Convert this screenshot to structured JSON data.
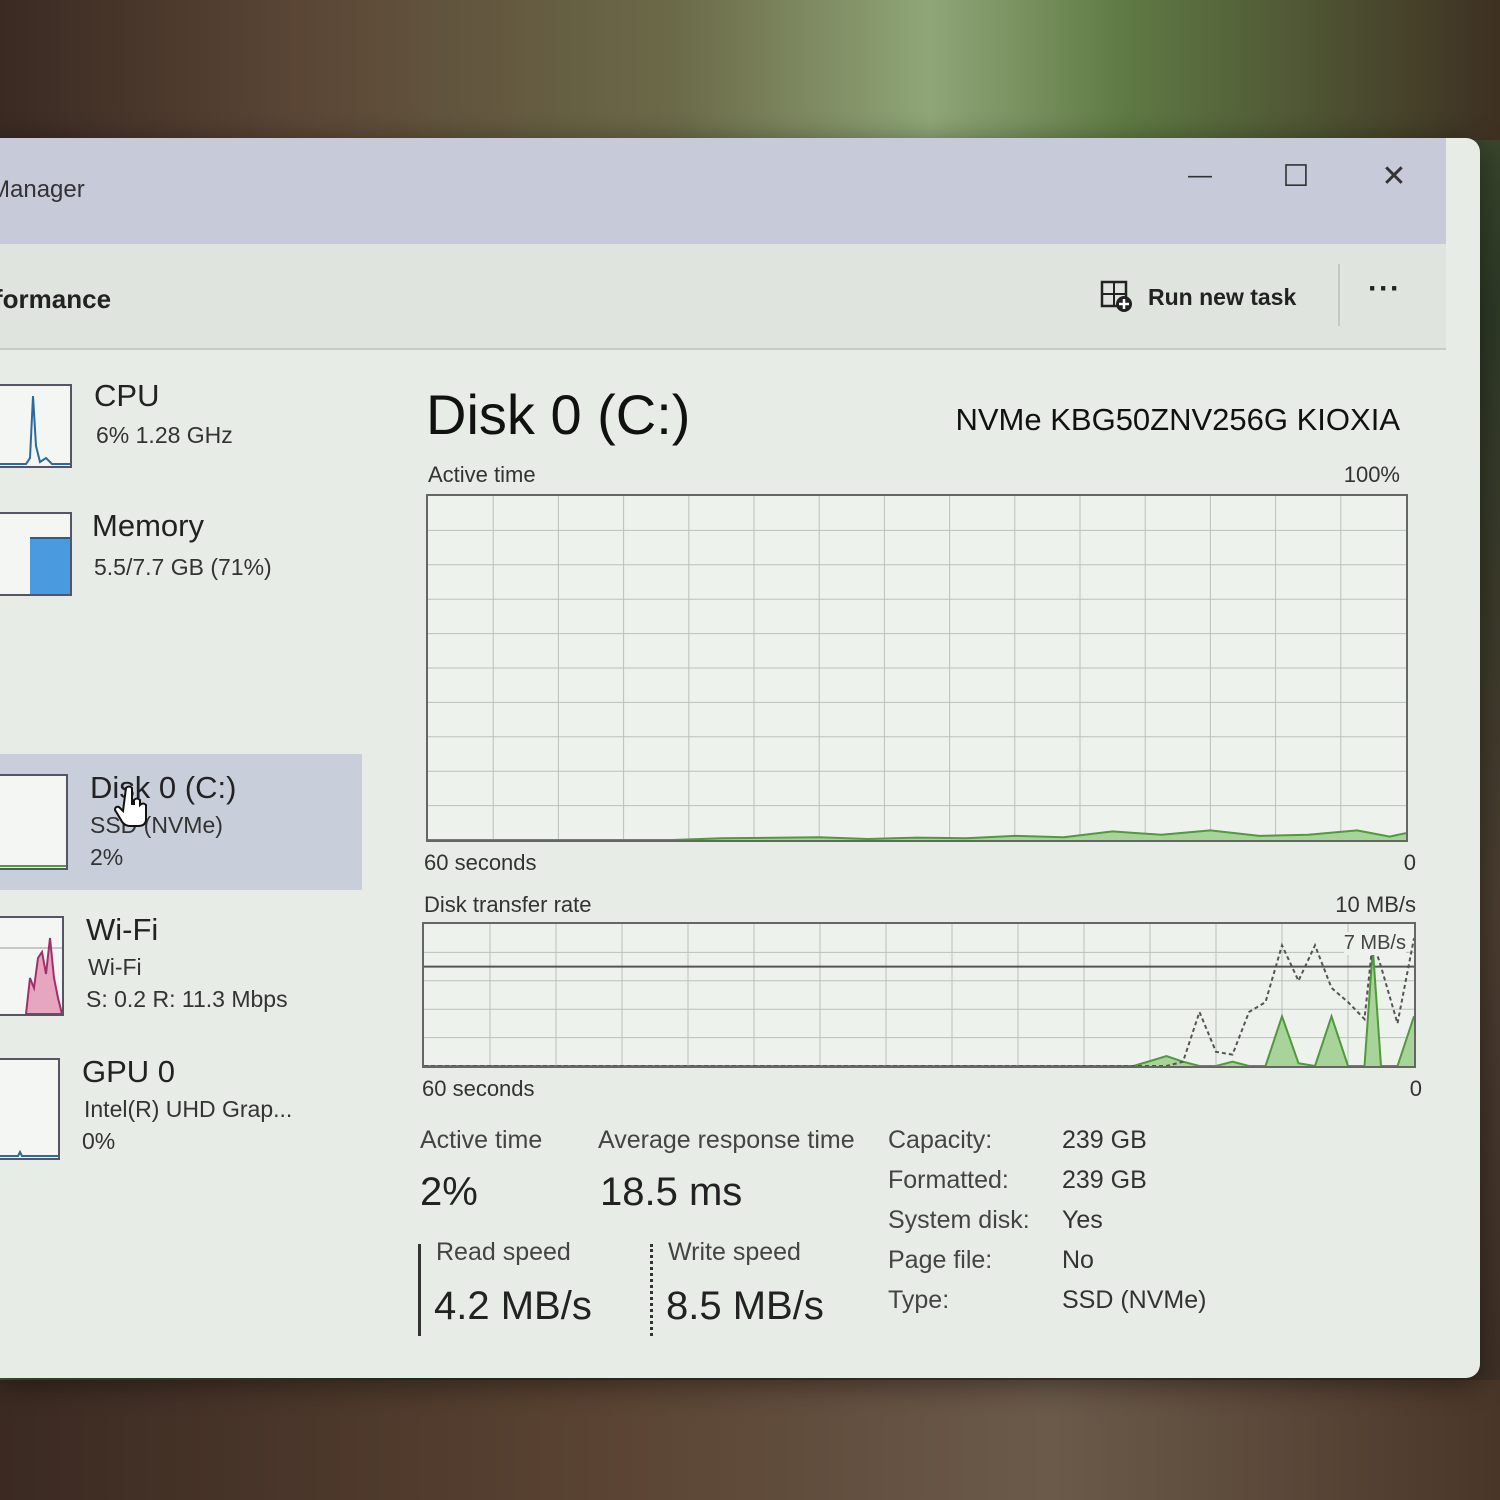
{
  "window": {
    "title": "Manager",
    "controls": {
      "minimize": "—",
      "maximize": "☐",
      "close": "✕"
    }
  },
  "toolbar": {
    "page_title": "formance",
    "run_task_label": "Run new task",
    "more_label": "···"
  },
  "sidebar": {
    "items": [
      {
        "title": "CPU",
        "sub1": "6%  1.28 GHz",
        "sub2": "",
        "graph_color": "#2b6a9a"
      },
      {
        "title": "Memory",
        "sub1": "5.5/7.7 GB (71%)",
        "sub2": "",
        "graph_color": "#2f8ad6",
        "fill": 0.71
      },
      {
        "title": "Disk 0 (C:)",
        "sub1": "SSD (NVMe)",
        "sub2": "2%",
        "graph_color": "#4f9a3a",
        "selected": true
      },
      {
        "title": "Wi-Fi",
        "sub1": "Wi-Fi",
        "sub2": "S: 0.2  R: 11.3 Mbps",
        "graph_color": "#b04a7a"
      },
      {
        "title": "GPU 0",
        "sub1": "Intel(R) UHD Grap...",
        "sub2": "0%",
        "graph_color": "#2b6a9a"
      }
    ]
  },
  "main": {
    "title": "Disk 0 (C:)",
    "model": "NVMe KBG50ZNV256G KIOXIA",
    "active_graph": {
      "label": "Active time",
      "max_label": "100%",
      "x_left": "60 seconds",
      "x_right": "0"
    },
    "transfer_graph": {
      "label": "Disk transfer rate",
      "max_label": "10 MB/s",
      "ref_label": "7 MB/s",
      "x_left": "60 seconds",
      "x_right": "0"
    },
    "stats": {
      "active_time_label": "Active time",
      "active_time_value": "2%",
      "response_label": "Average response time",
      "response_value": "18.5 ms",
      "read_label": "Read speed",
      "read_value": "4.2 MB/s",
      "write_label": "Write speed",
      "write_value": "8.5 MB/s"
    },
    "properties": [
      {
        "label": "Capacity:",
        "value": "239 GB"
      },
      {
        "label": "Formatted:",
        "value": "239 GB"
      },
      {
        "label": "System disk:",
        "value": "Yes"
      },
      {
        "label": "Page file:",
        "value": "No"
      },
      {
        "label": "Type:",
        "value": "SSD (NVMe)"
      }
    ]
  },
  "colors": {
    "disk_line": "#4f9a3a",
    "disk_fill": "#a8d39a",
    "grid": "#b8c2b8"
  },
  "chart_data": [
    {
      "type": "area",
      "title": "Active time",
      "ylabel": "%",
      "ylim": [
        0,
        100
      ],
      "x": [
        -60,
        -45,
        -42,
        -36,
        -33,
        -30,
        -27,
        -24,
        -21,
        -18,
        -15,
        -12,
        -9,
        -6,
        -3,
        -1,
        0
      ],
      "values": [
        0,
        0,
        0.5,
        0.8,
        0.3,
        0.7,
        0.5,
        1.2,
        0.8,
        2.5,
        1.5,
        2.8,
        1.2,
        1.5,
        2.8,
        1.0,
        2.0
      ]
    },
    {
      "type": "line",
      "title": "Disk transfer rate",
      "ylabel": "MB/s",
      "ylim": [
        0,
        10
      ],
      "x": [
        -60,
        -17,
        -15,
        -14,
        -13,
        -12,
        -11,
        -10,
        -9,
        -8,
        -7,
        -6,
        -5,
        -4,
        -3,
        -2.5,
        -2,
        -1,
        0
      ],
      "series": [
        {
          "name": "Read speed",
          "values": [
            0,
            0,
            0.7,
            0.3,
            0,
            0,
            0.3,
            0,
            0,
            3.5,
            0.2,
            0,
            3.5,
            0,
            0,
            8.3,
            0,
            0,
            3.5
          ]
        },
        {
          "name": "Write speed",
          "values": [
            0,
            0,
            0,
            0.3,
            3.8,
            1.0,
            0.8,
            3.8,
            4.5,
            8.5,
            6.0,
            8.5,
            5.5,
            4.5,
            3.3,
            8.8,
            7.0,
            3.0,
            9.0
          ]
        }
      ]
    }
  ]
}
